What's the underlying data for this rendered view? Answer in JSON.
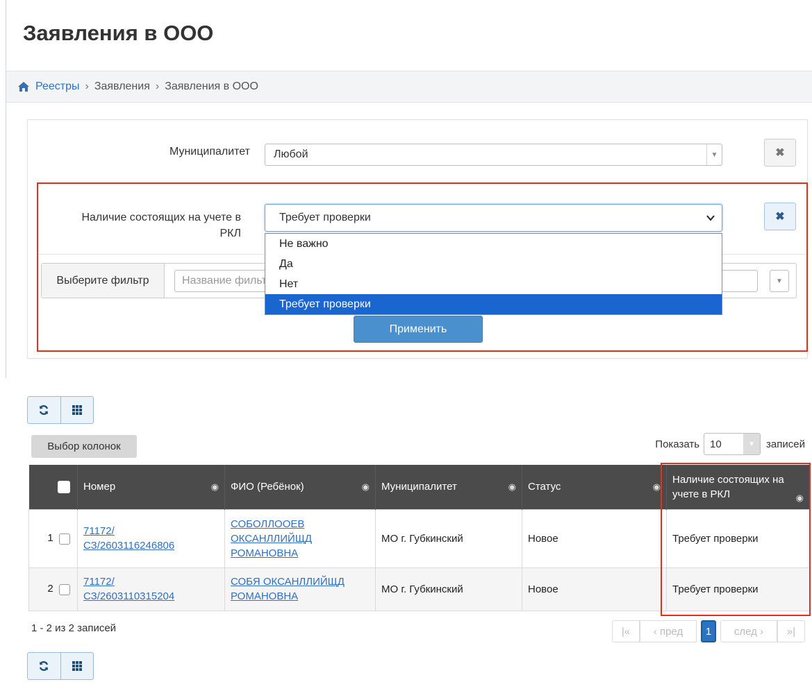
{
  "page": {
    "title": "Заявления в ООО"
  },
  "breadcrumb": {
    "home": "Реестры",
    "level2": "Заявления",
    "level3": "Заявления в ООО",
    "home_icon": "home-icon",
    "separator": "›"
  },
  "filters": {
    "municipality": {
      "label": "Муниципалитет",
      "value": "Любой"
    },
    "rkl": {
      "label_line1": "Наличие состоящих на учете в",
      "label_line2": "РКЛ",
      "value": "Требует проверки",
      "options": [
        "Не важно",
        "Да",
        "Нет",
        "Требует проверки"
      ],
      "selected_index": 3
    },
    "filter_select": {
      "addon": "Выберите фильтр",
      "placeholder": "Название фильтра"
    },
    "apply_label": "Применить",
    "clear_glyph": "✖"
  },
  "toolbar": {
    "refresh_icon": "refresh-icon",
    "grid_icon": "grid-icon"
  },
  "list_controls": {
    "columns_button": "Выбор колонок",
    "show_prefix": "Показать",
    "page_size": "10",
    "show_suffix": "записей"
  },
  "table": {
    "headers": {
      "number": "Номер",
      "fio": "ФИО (Ребёнок)",
      "municipality": "Муниципалитет",
      "status": "Статус",
      "rkl": "Наличие состоящих на учете в РКЛ"
    },
    "rows": [
      {
        "idx": "1",
        "number": "71172/ СЗ/2603116246806",
        "fio": "СОБОЛЛООЕВ ОКСАНЛЛИЙЩД РОМАНОВНА",
        "municipality": "МО г. Губкинский",
        "status": "Новое",
        "rkl": "Требует проверки"
      },
      {
        "idx": "2",
        "number": "71172/ СЗ/2603110315204",
        "fio": "СОБЯ ОКСАНЛЛИЙЩД РОМАНОВНА",
        "municipality": "МО г. Губкинский",
        "status": "Новое",
        "rkl": "Требует проверки"
      }
    ]
  },
  "footer": {
    "records_info": "1 - 2 из 2 записей",
    "pager": {
      "first": "|«",
      "prev": "‹ пред",
      "current": "1",
      "next": "след ›",
      "last": "»|"
    }
  },
  "colors": {
    "accent": "#2e70c3",
    "highlight_border": "#e0301e",
    "header_bg": "#4b4b4b",
    "selected_option": "#1a66d0"
  }
}
